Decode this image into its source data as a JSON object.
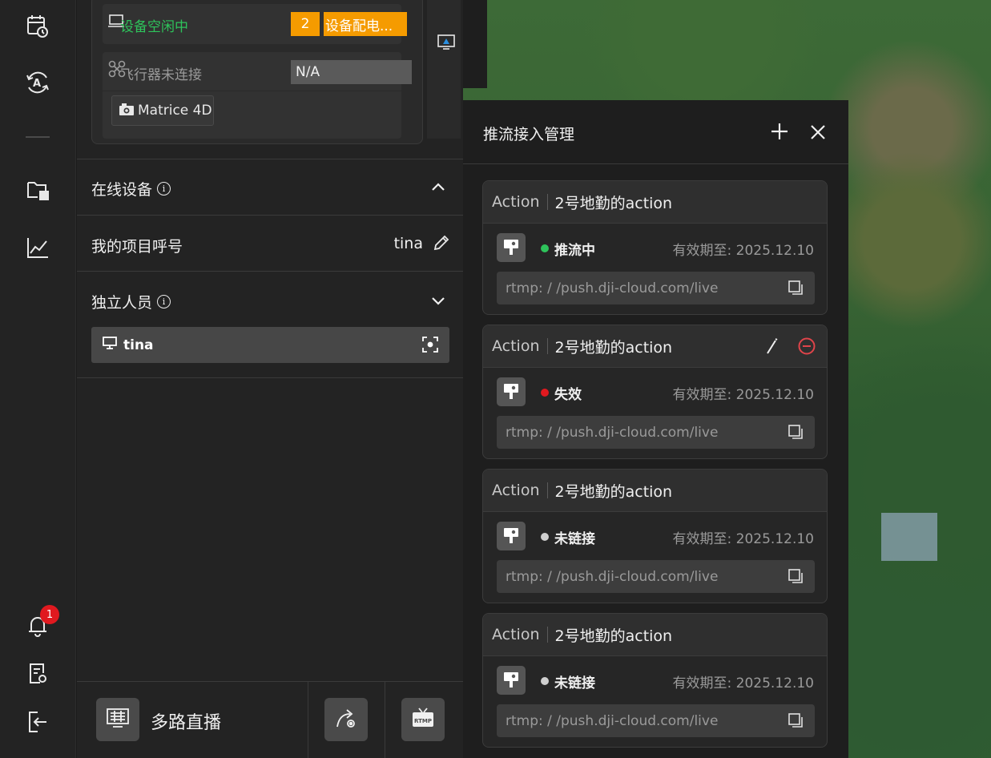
{
  "rail": {
    "notification_count": "1",
    "icons": [
      "schedule-icon",
      "auto-route-icon",
      "media-files-icon",
      "chart-icon",
      "bell-icon",
      "log-icon",
      "logout-icon"
    ]
  },
  "device_card": {
    "status_idle": "设备空闲中",
    "count": "2",
    "action_label": "设备配电...",
    "aircraft_status": "飞行器未连接",
    "aircraft_value": "N/A",
    "model": "Matrice 4D",
    "status_color": "#2ec35b",
    "accent_color": "#f59b00"
  },
  "sections": {
    "online_devices": "在线设备",
    "my_callsign_label": "我的项目呼号",
    "my_callsign_value": "tina",
    "independent_personnel": "独立人员",
    "person_name": "tina"
  },
  "bottom_bar": {
    "multi_live_label": "多路直播"
  },
  "stream_manager": {
    "title": "推流接入管理",
    "cards": [
      {
        "type": "Action",
        "name": "2号地勤的action",
        "status": "推流中",
        "status_color": "#2ec35b",
        "expiry": "有效期至: 2025.12.10",
        "url": "rtmp: / /push.dji-cloud.com/live",
        "editable": false
      },
      {
        "type": "Action",
        "name": "2号地勤的action",
        "status": "失效",
        "status_color": "#e0191f",
        "expiry": "有效期至: 2025.12.10",
        "url": "rtmp: / /push.dji-cloud.com/live",
        "editable": true
      },
      {
        "type": "Action",
        "name": "2号地勤的action",
        "status": "未链接",
        "status_color": "#cfcfcf",
        "expiry": "有效期至: 2025.12.10",
        "url": "rtmp: / /push.dji-cloud.com/live",
        "editable": false
      },
      {
        "type": "Action",
        "name": "2号地勤的action",
        "status": "未链接",
        "status_color": "#cfcfcf",
        "expiry": "有效期至: 2025.12.10",
        "url": "rtmp: / /push.dji-cloud.com/live",
        "editable": false
      }
    ]
  }
}
